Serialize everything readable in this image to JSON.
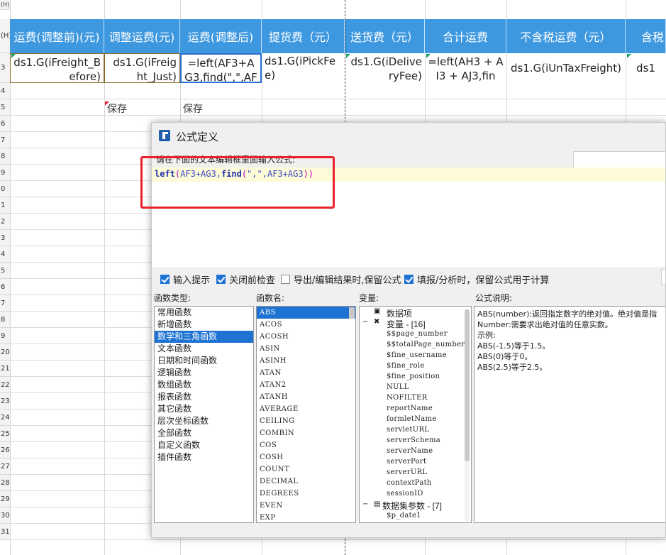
{
  "sheet": {
    "top_fragment": "(H)",
    "row_numbers": [
      "(H)",
      "3",
      "4",
      "5",
      "6",
      "7",
      "8",
      "9",
      "0",
      "1",
      "2",
      "3",
      "4",
      "5",
      "6",
      "7",
      "8",
      "9",
      "20",
      "21",
      "22",
      "23",
      "24",
      "25",
      "26",
      "27",
      "28",
      "29",
      "30",
      "31"
    ],
    "headers": [
      "运费(调整前)(元)",
      "调整运费(元)",
      "运费(调整后)",
      "提货费（元）",
      "送货费（元）",
      "合计运费",
      "不含税运费（元）",
      "含税"
    ],
    "cells": [
      "ds1.G(iFreight_Before)",
      "ds1.G(iFreight_Just)",
      "=left(AF3+AG3,find(\",\",AF3+",
      "ds1.G(iPickFee)",
      "ds1.G(iDeliveryFee)",
      "=left(AH3 + AI3 + AJ3,fin",
      "ds1.G(iUnTaxFreight)",
      "ds1"
    ],
    "save_labels": [
      "保存",
      "保存"
    ]
  },
  "dialog": {
    "title": "公式定义",
    "hint": "请在下面的文本编辑框里面输入公式:",
    "formula": {
      "fn1": "left",
      "p1": "(",
      "a1": "AF3+AG3,",
      "fn2": "find",
      "p2": "(",
      "a2": "\",\",AF3+AG3",
      "p3": "))"
    },
    "options": [
      {
        "label": "输入提示",
        "checked": true
      },
      {
        "label": "关闭前检查",
        "checked": true
      },
      {
        "label": "导出/编辑结果时,保留公式",
        "checked": false
      },
      {
        "label": "填报/分析时，保留公式用于计算",
        "checked": true
      }
    ],
    "func_type_label": "函数类型:",
    "func_name_label": "函数名:",
    "var_label": "变量:",
    "desc_label": "公式说明:",
    "func_types": [
      "常用函数",
      "新增函数",
      "数学和三角函数",
      "文本函数",
      "日期和时间函数",
      "逻辑函数",
      "数组函数",
      "报表函数",
      "其它函数",
      "层次坐标函数",
      "全部函数",
      "自定义函数",
      "插件函数"
    ],
    "func_types_selected": "数学和三角函数",
    "func_names": [
      "ABS",
      "ACOS",
      "ACOSH",
      "ASIN",
      "ASINH",
      "ATAN",
      "ATAN2",
      "ATANH",
      "AVERAGE",
      "CEILING",
      "COMBIN",
      "COS",
      "COSH",
      "COUNT",
      "DECIMAL",
      "DEGREES",
      "EVEN",
      "EXP"
    ],
    "func_names_selected": "ABS",
    "vars": {
      "data_items": "数据项",
      "variables": "变量 - [16]",
      "var_items": [
        "$$page_number",
        "$$totalPage_number",
        "$fine_username",
        "$fine_role",
        "$fine_position",
        "NULL",
        "NOFILTER",
        "reportName",
        "formletName",
        "servletURL",
        "serverSchema",
        "serverName",
        "serverPort",
        "serverURL",
        "contextPath",
        "sessionID"
      ],
      "dataset_params": "数据集参数 - [7]",
      "dataset_first": "$p_date1"
    },
    "description": [
      "ABS(number):返回指定数字的绝对值。绝对值是指",
      "Number:需要求出绝对值的任意实数。",
      "示例:",
      "ABS(-1.5)等于1.5。",
      "ABS(0)等于0。",
      "ABS(2.5)等于2.5。"
    ]
  },
  "colors": {
    "header_blue": "#3e98e0",
    "selection_blue": "#1e73d2",
    "highlight_red": "#e8242a",
    "formula_line": "#fefbd8"
  }
}
